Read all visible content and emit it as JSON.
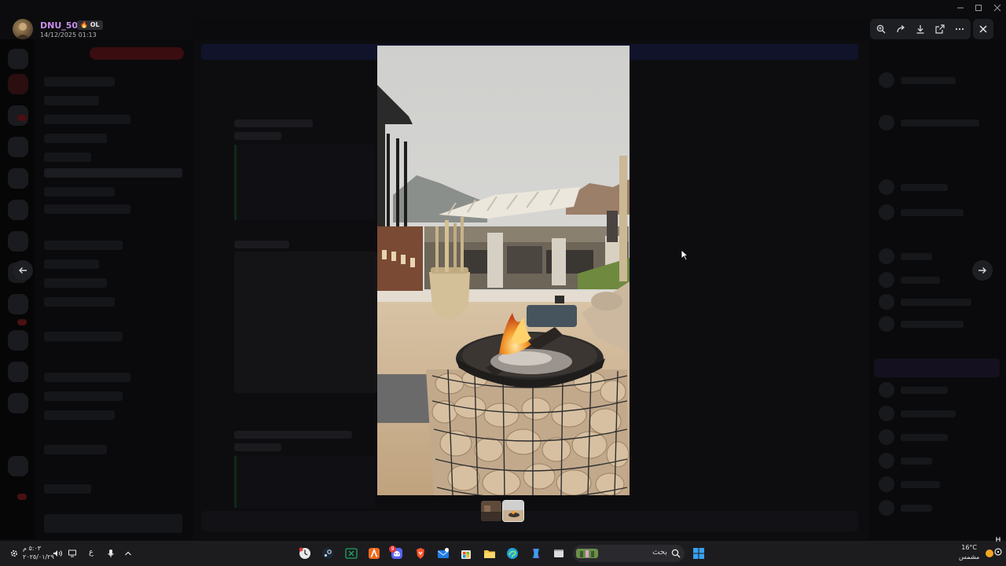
{
  "viewer": {
    "author": "DNU_501",
    "author_tag": "OL",
    "timestamp": "14/12/2025 01:13",
    "toolbar": [
      "zoom-in-icon",
      "forward-icon",
      "download-icon",
      "open-external-icon",
      "more-icon"
    ],
    "close": "close-icon",
    "nav": {
      "prev": "arrow-left-icon",
      "next": "arrow-right-icon"
    },
    "attachments_count": 2,
    "current_attachment": 2
  },
  "window_controls": [
    "minimize-icon",
    "maximize-icon",
    "close-window-icon"
  ],
  "taskbar": {
    "clock_time": "٥:٠٣ م",
    "clock_date": "٢٠٢٥/٠١/٢٩",
    "language": "ع",
    "search_placeholder": "بحث",
    "weather_temp": "16°C",
    "weather_desc": "مشمس",
    "pinned": [
      "clock-icon",
      "steam-icon",
      "excel-icon",
      "app-a-icon",
      "discord-icon",
      "brave-icon",
      "mail-icon",
      "store-icon",
      "files-icon",
      "edge-icon",
      "copilot-icon",
      "window-icon"
    ],
    "discord_badge": "9"
  },
  "colors": {
    "username": "#c98df0",
    "viewer_ui": "#1e1f22",
    "taskbar": "#1c1c1f"
  }
}
